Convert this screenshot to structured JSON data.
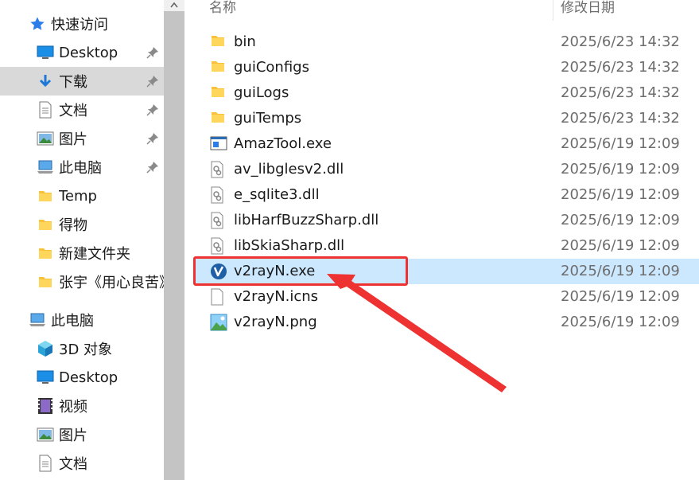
{
  "nav": {
    "items": [
      {
        "label": "快速访问",
        "icon": "star-icon",
        "pinned": false,
        "selected": false
      },
      {
        "label": "Desktop",
        "icon": "desktop-icon",
        "pinned": true,
        "selected": false
      },
      {
        "label": "下载",
        "icon": "download-icon",
        "pinned": true,
        "selected": true
      },
      {
        "label": "文档",
        "icon": "document-icon",
        "pinned": true,
        "selected": false
      },
      {
        "label": "图片",
        "icon": "picture-icon",
        "pinned": true,
        "selected": false
      },
      {
        "label": "此电脑",
        "icon": "computer-icon",
        "pinned": true,
        "selected": false
      },
      {
        "label": "Temp",
        "icon": "folder-icon",
        "pinned": false,
        "selected": false
      },
      {
        "label": "得物",
        "icon": "folder-icon",
        "pinned": false,
        "selected": false
      },
      {
        "label": "新建文件夹",
        "icon": "folder-icon",
        "pinned": false,
        "selected": false
      },
      {
        "label": "张宇《用心良苦》",
        "icon": "folder-icon",
        "pinned": false,
        "selected": false
      },
      {
        "label": "此电脑",
        "icon": "computer-icon",
        "pinned": false,
        "selected": false
      },
      {
        "label": "3D 对象",
        "icon": "cube-icon",
        "pinned": false,
        "selected": false
      },
      {
        "label": "Desktop",
        "icon": "desktop-icon",
        "pinned": false,
        "selected": false
      },
      {
        "label": "视频",
        "icon": "video-icon",
        "pinned": false,
        "selected": false
      },
      {
        "label": "图片",
        "icon": "picture-icon",
        "pinned": false,
        "selected": false
      },
      {
        "label": "文档",
        "icon": "document-icon",
        "pinned": false,
        "selected": false
      }
    ]
  },
  "columns": {
    "name": "名称",
    "modified": "修改日期"
  },
  "files": [
    {
      "name": "bin",
      "date": "2025/6/23 14:32",
      "icon": "folder-icon",
      "selected": false
    },
    {
      "name": "guiConfigs",
      "date": "2025/6/23 14:32",
      "icon": "folder-icon",
      "selected": false
    },
    {
      "name": "guiLogs",
      "date": "2025/6/23 14:32",
      "icon": "folder-icon",
      "selected": false
    },
    {
      "name": "guiTemps",
      "date": "2025/6/23 14:32",
      "icon": "folder-icon",
      "selected": false
    },
    {
      "name": "AmazTool.exe",
      "date": "2025/6/19 12:09",
      "icon": "app-window-icon",
      "selected": false
    },
    {
      "name": "av_libglesv2.dll",
      "date": "2025/6/19 12:09",
      "icon": "dll-gear-icon",
      "selected": false
    },
    {
      "name": "e_sqlite3.dll",
      "date": "2025/6/19 12:09",
      "icon": "dll-gear-icon",
      "selected": false
    },
    {
      "name": "libHarfBuzzSharp.dll",
      "date": "2025/6/19 12:09",
      "icon": "dll-gear-icon",
      "selected": false
    },
    {
      "name": "libSkiaSharp.dll",
      "date": "2025/6/19 12:09",
      "icon": "dll-gear-icon",
      "selected": false
    },
    {
      "name": "v2rayN.exe",
      "date": "2025/6/19 12:09",
      "icon": "v2rayn-logo-icon",
      "selected": true
    },
    {
      "name": "v2rayN.icns",
      "date": "2025/6/19 12:09",
      "icon": "blank-file-icon",
      "selected": false
    },
    {
      "name": "v2rayN.png",
      "date": "2025/6/19 12:09",
      "icon": "image-file-icon",
      "selected": false
    }
  ],
  "colors": {
    "selection": "#cce8ff",
    "nav_selection": "#d9d9d9",
    "annotation": "#ee3131",
    "folder": "#f8c33a"
  }
}
